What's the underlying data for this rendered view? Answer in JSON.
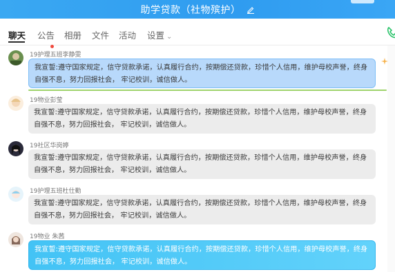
{
  "window": {
    "title": "助学贷款（社物殡护）"
  },
  "tabs": [
    {
      "label": "聊天"
    },
    {
      "label": "公告"
    },
    {
      "label": "相册"
    },
    {
      "label": "文件"
    },
    {
      "label": "活动"
    },
    {
      "label": "设置"
    }
  ],
  "messages": [
    {
      "sender": "19护理五班李静雯",
      "text": "我宣誓:遵守国家规定，信守贷款承诺，认真履行合约，按期偿还贷款，珍惜个人信用，维护母校声誉，终身自强不息，努力回报社会，  牢记校训，诚信做人。"
    },
    {
      "sender": "19物业彭莹",
      "text": "我宣誓:遵守国家规定，信守贷款承诺，认真履行合约，按期偿还贷款，珍惜个人信用，维护母校声誉，终身自强不息，努力回报社会，  牢记校训，诚信做人。"
    },
    {
      "sender": "19社区华岗婷",
      "text": "我宣誓:遵守国家规定，信守贷款承诺，认真履行合约，按期偿还贷款，珍惜个人信用，维护母校声誉，终身自强不息，努力回报社会，  牢记校训，诚信做人。"
    },
    {
      "sender": "19护理五班杜仕勤",
      "text": "我宣誓:遵守国家规定，信守贷款承诺，认真履行合约，按期偿还贷款，珍惜个人信用，维护母校声誉，终身自强不息，努力回报社会，  牢记校训，诚信做人。"
    },
    {
      "sender": "19物业 朱茜",
      "text": "我宣誓:遵守国家规定，信守贷款承诺，认真履行合约，按期偿还贷款，珍惜个人信用，维护母校声誉，终身自强不息，努力回报社会，  牢记校训，诚信做人。"
    }
  ],
  "colors": {
    "accent": "#2f9cf0",
    "unread_dot": "#f04a3e",
    "bubble_blue": "#b8d9fb",
    "bubble_cyan": "#43c3f5"
  }
}
